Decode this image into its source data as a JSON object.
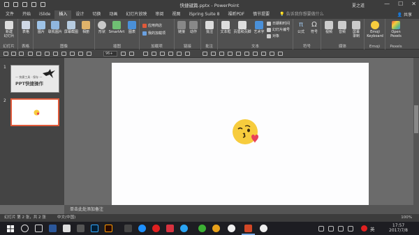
{
  "window": {
    "title": "快捷键篇.pptx  -  PowerPoint",
    "user": "夏之道",
    "share": "共享",
    "min": "—",
    "max": "☐",
    "close": "✕"
  },
  "tabs": [
    {
      "label": "文件"
    },
    {
      "label": "开始"
    },
    {
      "label": "iSlide"
    },
    {
      "label": "插入",
      "active": true
    },
    {
      "label": "设计"
    },
    {
      "label": "切换"
    },
    {
      "label": "动画"
    },
    {
      "label": "幻灯片放映"
    },
    {
      "label": "审阅"
    },
    {
      "label": "视图"
    },
    {
      "label": "iSpring Suite 8"
    },
    {
      "label": "福昕PDF"
    },
    {
      "label": "慎节提要"
    }
  ],
  "tell_me": "告诉我你想要做什么",
  "ribbon": {
    "groups": [
      {
        "label": "幻灯片",
        "buttons": [
          "新建\n幻灯片"
        ]
      },
      {
        "label": "表格",
        "buttons": [
          "表格"
        ]
      },
      {
        "label": "图像",
        "buttons": [
          "图片",
          "联机图片",
          "屏幕截图",
          "相册"
        ]
      },
      {
        "label": "插图",
        "buttons": [
          "形状",
          "SmartArt",
          "图表"
        ]
      },
      {
        "label": "加载项",
        "buttons": [
          "应用商店",
          "我的加载项"
        ]
      },
      {
        "label": "链接",
        "buttons": [
          "链接",
          "动作"
        ]
      },
      {
        "label": "批注",
        "buttons": [
          "批注"
        ]
      },
      {
        "label": "文本",
        "buttons": [
          "文本框",
          "页眉和页脚",
          "艺术字",
          "日期和时间",
          "幻灯片编号",
          "对象"
        ]
      },
      {
        "label": "符号",
        "buttons": [
          "公式",
          "符号"
        ]
      },
      {
        "label": "媒体",
        "buttons": [
          "视频",
          "音频",
          "屏幕\n录制"
        ]
      },
      {
        "label": "Emoji",
        "buttons": [
          "Emoji\nKeyboard"
        ]
      },
      {
        "label": "Pexels",
        "buttons": [
          "Open\nPexels"
        ]
      }
    ]
  },
  "format_bar": {
    "font_size": "96+"
  },
  "slides_panel": {
    "items": [
      {
        "number": "1",
        "title": "PPT快捷操作",
        "subtitle": "— 快捷工具 · 保存 —"
      },
      {
        "number": "2",
        "title": ""
      }
    ]
  },
  "notes_placeholder": "单击此处添加备注",
  "status": {
    "slide_info": "幻灯片 第 2 张，共 2 张",
    "language": "中文(中国)",
    "zoom": "100%"
  },
  "taskbar": {
    "time": "17:57",
    "date": "2017/7/8",
    "ime": "英"
  },
  "colors": {
    "accent": "#d24726",
    "emoji_face": "#f7cc3d",
    "heart": "#e8415a"
  }
}
